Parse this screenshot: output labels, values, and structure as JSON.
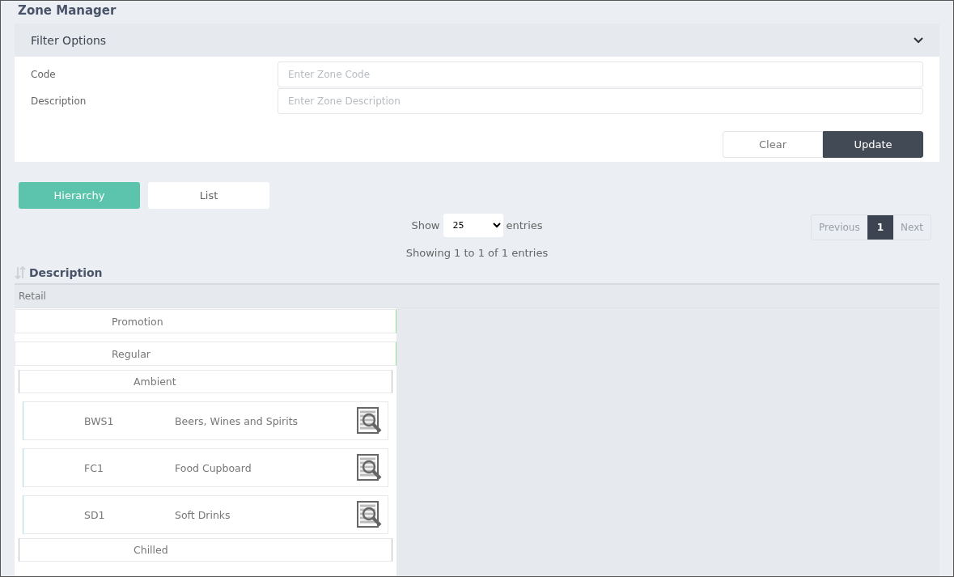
{
  "page_title": "Zone Manager",
  "filter": {
    "title": "Filter Options",
    "expanded": true,
    "fields": [
      {
        "label": "Code",
        "placeholder": "Enter Zone Code"
      },
      {
        "label": "Description",
        "placeholder": "Enter Zone Description"
      }
    ],
    "buttons": [
      {
        "label": "Clear",
        "kind": "secondary"
      },
      {
        "label": "Update",
        "kind": "primary"
      }
    ]
  },
  "view_tabs": [
    {
      "label": "Hierarchy",
      "selected": true
    },
    {
      "label": "List",
      "selected": false
    }
  ],
  "length": {
    "prefix": "Show",
    "value": "25",
    "suffix": "entries"
  },
  "pagination": [
    {
      "label": "Previous",
      "selected": false,
      "disabled": true
    },
    {
      "label": "1",
      "selected": true,
      "disabled": false
    },
    {
      "label": "Next",
      "selected": false,
      "disabled": true
    }
  ],
  "info": "Showing 1 to 1 of 1 entries",
  "column": "Description",
  "tree": {
    "label": "Retail",
    "children": [
      {
        "kind": "group",
        "label": "Promotion"
      },
      {
        "kind": "group",
        "label": "Regular",
        "children": [
          {
            "kind": "group",
            "label": "Ambient",
            "children": [
              {
                "kind": "zone",
                "code": "BWS1",
                "description": "Beers, Wines and Spirits"
              },
              {
                "kind": "zone",
                "code": "FC1",
                "description": "Food Cupboard"
              },
              {
                "kind": "zone",
                "code": "SD1",
                "description": "Soft Drinks"
              }
            ]
          },
          {
            "kind": "group",
            "label": "Chilled"
          }
        ]
      }
    ]
  }
}
